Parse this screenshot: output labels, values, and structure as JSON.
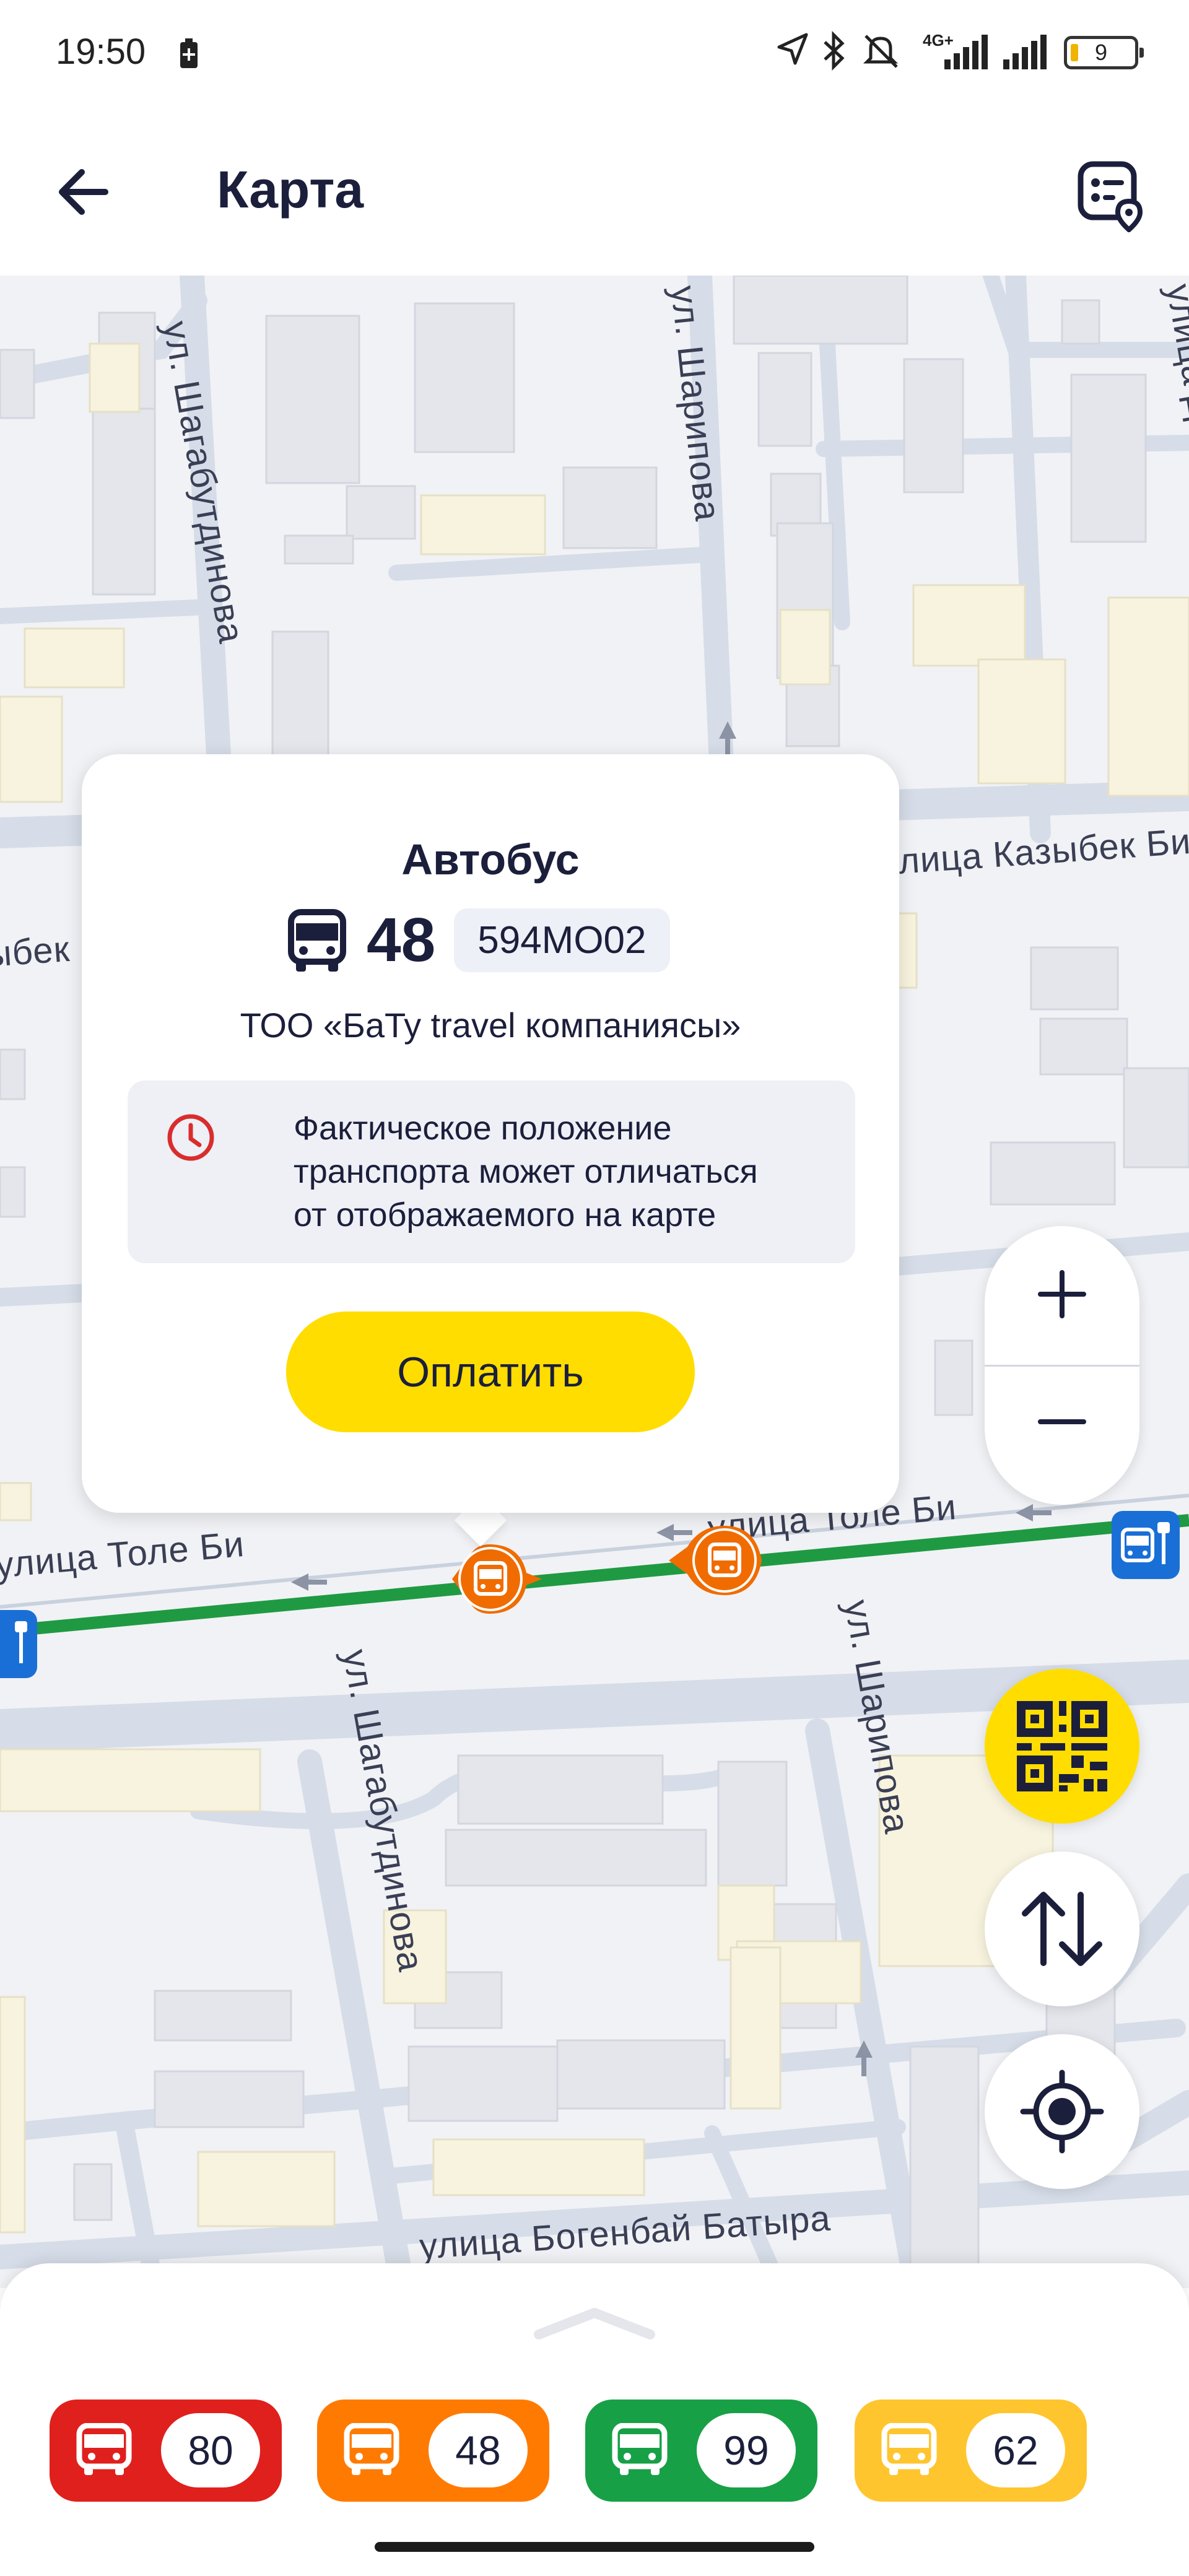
{
  "status_bar": {
    "time": "19:50",
    "network": "4G+",
    "battery": "9"
  },
  "header": {
    "title": "Карта",
    "back_icon": "arrow-left-icon",
    "action_icon": "route-map-icon"
  },
  "map": {
    "streets": {
      "shagabutdinova_top": "ул. Шагабутдинова",
      "sharipova_top": "ул. Шарипова",
      "dosmukhamedov": "улица Досмухамедова",
      "kazybek_bi": "улица Казыбек Би",
      "kazybek_bi_left": "Казыбек",
      "tole_bi_left": "улица Толе Би",
      "tole_bi_right": "улица Толе Би",
      "shagabutdinova_bottom": "ул. Шагабутдинова",
      "sharipova_bottom": "ул. Шарипова",
      "bogenbai": "улица Богенбай Батыра"
    }
  },
  "popup": {
    "type": "Автобус",
    "route": "48",
    "plate": "594МО02",
    "company": "ТОО «БаТу travel компаниясы»",
    "notice": "Фактическое положение\nтранспорта может отличаться\nот отображаемого на карте",
    "pay_button": "Оплатить"
  },
  "controls": {
    "zoom_in": "+",
    "zoom_out": "−",
    "qr_icon": "qr-code-icon",
    "swap_icon": "swap-vertical-icon",
    "locate_icon": "locate-icon"
  },
  "routes": [
    {
      "number": "80",
      "color": "#e0201c"
    },
    {
      "number": "48",
      "color": "#ff7a00"
    },
    {
      "number": "99",
      "color": "#17a045"
    },
    {
      "number": "62",
      "color": "#ffc52e"
    }
  ],
  "colors": {
    "accent_yellow": "#ffdd00",
    "route_green": "#1f9a43",
    "marker_orange": "#f06c00",
    "stop_blue": "#1a6fd6"
  }
}
